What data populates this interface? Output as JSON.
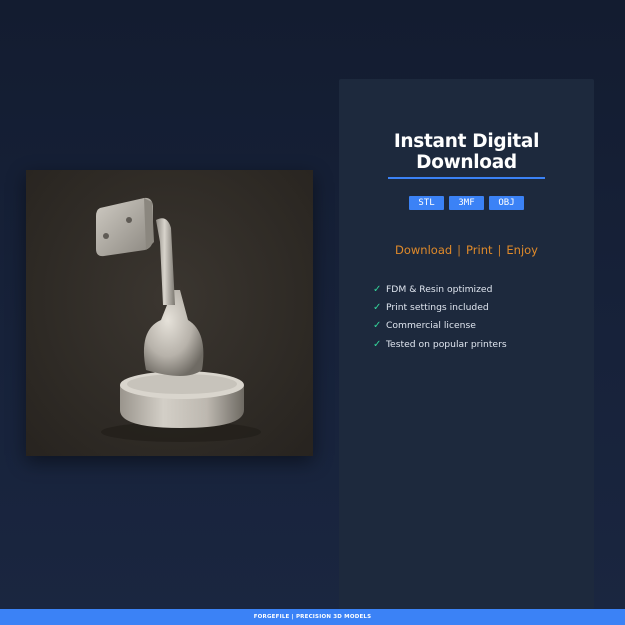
{
  "card": {
    "title_line1": "Instant Digital",
    "title_line2": "Download",
    "formats": [
      "STL",
      "3MF",
      "OBJ"
    ],
    "tagline": [
      "Download",
      "Print",
      "Enjoy"
    ],
    "features": [
      "FDM & Resin optimized",
      "Print settings included",
      "Commercial license",
      "Tested on popular printers"
    ]
  },
  "footer": {
    "text": "FORGEFILE | PRECISION 3D MODELS"
  },
  "colors": {
    "accent": "#3b82f6",
    "tagline": "#e08a2a",
    "check": "#34d399",
    "background": "#17223a",
    "card": "#1d293d"
  },
  "icons": {
    "feature_bullet": "check-icon"
  }
}
